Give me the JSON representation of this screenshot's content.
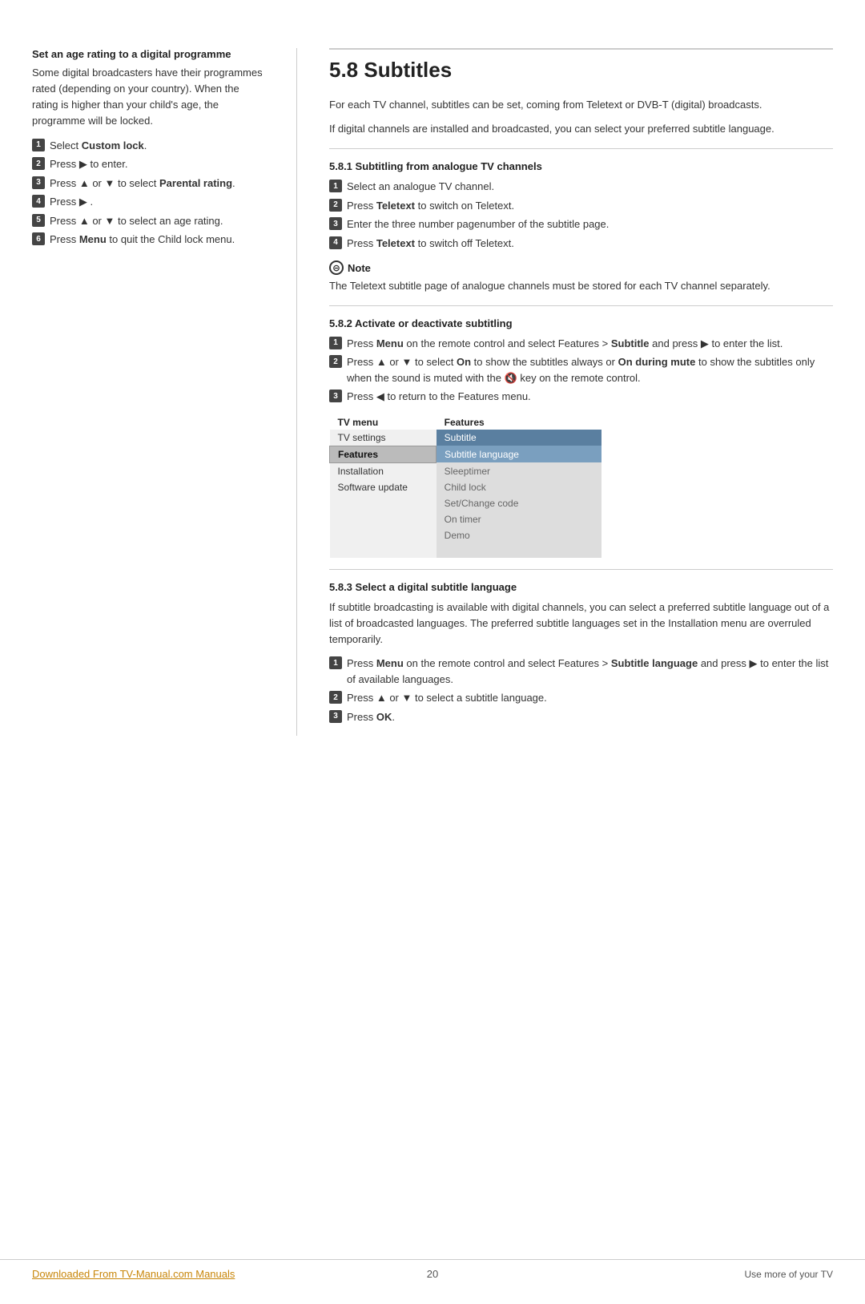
{
  "left": {
    "heading": "Set an age rating to a digital programme",
    "intro": "Some digital broadcasters have their programmes rated (depending on your country). When the rating is higher than your child's age, the programme will be locked.",
    "steps": [
      {
        "num": "1",
        "text": "Select ",
        "bold": "Custom lock",
        "after": "."
      },
      {
        "num": "2",
        "text": "Press ▶ to enter."
      },
      {
        "num": "3",
        "text": "Press ▲ or ▼ to select ",
        "bold": "Parental rating",
        "after": "."
      },
      {
        "num": "4",
        "text": "Press ▶ ."
      },
      {
        "num": "5",
        "text": "Press ▲ or ▼ to select an age rating."
      },
      {
        "num": "6",
        "text": "Press ",
        "bold": "Menu",
        "after": " to quit the Child lock menu."
      }
    ]
  },
  "right": {
    "main_title": "5.8   Subtitles",
    "intro1": "For each TV channel, subtitles can be set, coming from Teletext or DVB-T (digital) broadcasts.",
    "intro2": "If digital channels are installed and broadcasted, you can select your preferred subtitle language.",
    "sub581": {
      "title": "5.8.1   Subtitling from analogue TV channels",
      "steps": [
        {
          "num": "1",
          "text": "Select an analogue TV channel."
        },
        {
          "num": "2",
          "text": "Press ",
          "bold": "Teletext",
          "after": " to switch on Teletext."
        },
        {
          "num": "3",
          "text": "Enter the three number pagenumber of the subtitle page."
        },
        {
          "num": "4",
          "text": "Press ",
          "bold": "Teletext",
          "after": " to switch off Teletext."
        }
      ],
      "note_heading": "Note",
      "note_text": "The Teletext subtitle page of analogue channels must be stored for each TV channel separately."
    },
    "sub582": {
      "title": "5.8.2   Activate or deactivate subtitling",
      "steps": [
        {
          "num": "1",
          "text": "Press ",
          "bold": "Menu",
          "after": " on the remote control and select Features > ",
          "bold2": "Subtitle",
          "after2": " and press ▶ to enter the list."
        },
        {
          "num": "2",
          "text": "Press ▲ or ▼ to select ",
          "bold": "On",
          "after": " to show the subtitles always or ",
          "bold2": "On during mute",
          "after2": " to show the subtitles only when the sound is muted with the 🔇 key on the remote control."
        },
        {
          "num": "3",
          "text": "Press ◀ to return to the Features menu."
        }
      ],
      "table": {
        "header_left": "TV menu",
        "header_right": "Features",
        "rows": [
          {
            "left": "TV settings",
            "right": "Subtitle",
            "left_style": "normal",
            "right_style": "highlight"
          },
          {
            "left": "Features",
            "right": "Subtitle language",
            "left_style": "bold",
            "right_style": "normal"
          },
          {
            "left": "Installation",
            "right": "Sleeptimer",
            "left_style": "normal",
            "right_style": "muted"
          },
          {
            "left": "Software update",
            "right": "Child lock",
            "left_style": "normal",
            "right_style": "muted"
          },
          {
            "left": "",
            "right": "Set/Change code",
            "left_style": "normal",
            "right_style": "muted"
          },
          {
            "left": "",
            "right": "On timer",
            "left_style": "normal",
            "right_style": "muted"
          },
          {
            "left": "",
            "right": "Demo",
            "left_style": "normal",
            "right_style": "muted"
          },
          {
            "left": "",
            "right": "",
            "left_style": "normal",
            "right_style": "muted"
          }
        ]
      }
    },
    "sub583": {
      "title": "5.8.3   Select a digital subtitle language",
      "intro": "If subtitle broadcasting is available with digital channels, you can select a preferred subtitle language out of a list of broadcasted languages. The preferred subtitle languages set in the Installation menu are overruled temporarily.",
      "steps": [
        {
          "num": "1",
          "text": "Press ",
          "bold": "Menu",
          "after": " on the remote control and select Features > ",
          "bold2": "Subtitle language",
          "after2": " and press ▶ to enter the list of available languages."
        },
        {
          "num": "2",
          "text": "Press ▲ or ▼ to select a subtitle language."
        },
        {
          "num": "3",
          "text": "Press ",
          "bold": "OK",
          "after": "."
        }
      ]
    }
  },
  "footer": {
    "link_text": "Downloaded From TV-Manual.com Manuals",
    "page_num": "20",
    "right_text": "Use more of your TV"
  }
}
